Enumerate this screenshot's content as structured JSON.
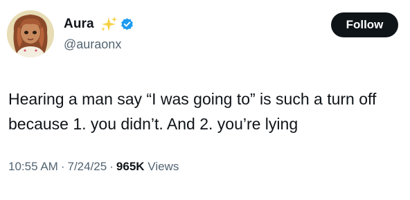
{
  "author": {
    "display_name": "Aura",
    "handle": "@auraonx",
    "name_emoji": "sparkles-icon",
    "verified_badge": "verified-badge-icon",
    "verified_color": "#1d9bf0"
  },
  "actions": {
    "follow_label": "Follow"
  },
  "tweet": {
    "text": "Hearing a man say “I was going to” is such a turn off because 1. you didn’t. And 2. you’re lying",
    "time": "10:55 AM",
    "date": "7/24/25",
    "separator": "·",
    "views_count": "965K",
    "views_label": "Views"
  },
  "colors": {
    "text_primary": "#0f1419",
    "text_secondary": "#536471",
    "button_bg": "#0f1419",
    "button_text": "#ffffff",
    "sparkle": "#f5d142"
  }
}
